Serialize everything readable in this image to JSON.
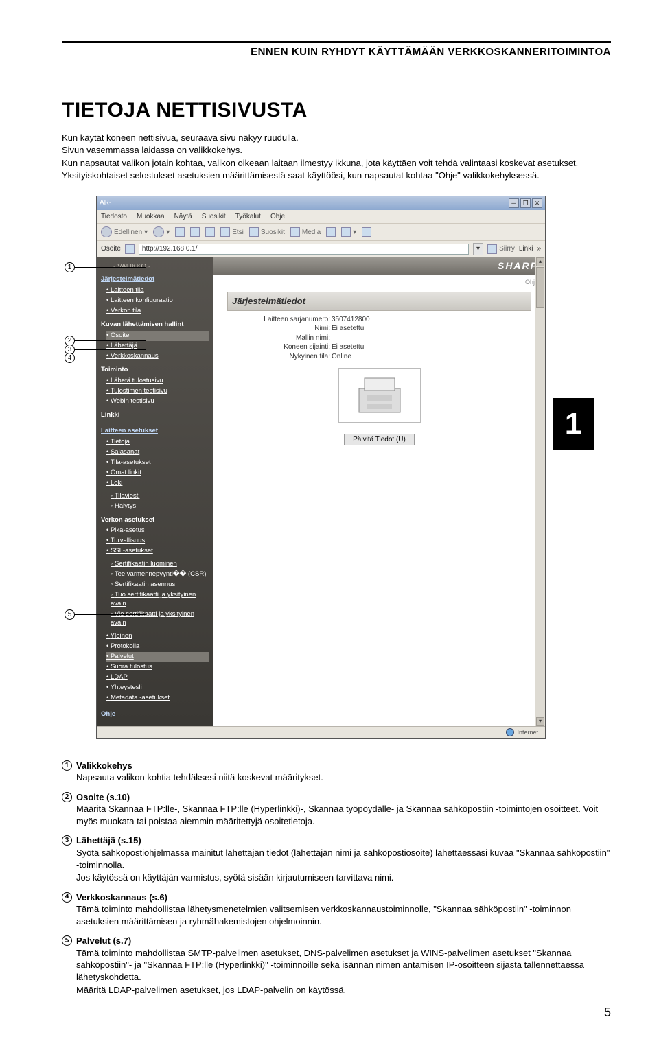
{
  "chapter": "ENNEN KUIN RYHDYT KÄYTTÄMÄÄN VERKKOSKANNERITOIMINTOA",
  "title": "TIETOJA NETTISIVUSTA",
  "intro": [
    "Kun käytät koneen nettisivua, seuraava sivu näkyy ruudulla.",
    "Sivun vasemmassa laidassa on valikkokehys.",
    "Kun napsautat valikon jotain kohtaa, valikon oikeaan laitaan ilmestyy ikkuna, jota käyttäen voit tehdä valintaasi koskevat asetukset.",
    "Yksityiskohtaiset selostukset asetuksien määrittämisestä saat käyttöösi, kun napsautat kohtaa \"Ohje\" valikkokehyksessä."
  ],
  "chapter_tab": "1",
  "browser": {
    "title": "AR-",
    "menus": [
      "Tiedosto",
      "Muokkaa",
      "Näytä",
      "Suosikit",
      "Työkalut",
      "Ohje"
    ],
    "toolbar": {
      "back": "Edellinen",
      "search": "Etsi",
      "fav": "Suosikit",
      "media": "Media"
    },
    "addr_label": "Osoite",
    "addr": "http://192.168.0.1/",
    "go": "Siirry",
    "links": "Linki",
    "sidebar": {
      "menu_header": "- VALIKKO -",
      "sys": "Järjestelmätiedot",
      "sys_items": [
        "Laitteen tila",
        "Laitteen konfiguraatio",
        "Verkon tila"
      ],
      "img": "Kuvan lähettämisen hallint",
      "img_items": [
        "Osoite",
        "Lähettäjä",
        "Verkkoskannaus"
      ],
      "toiminto": "Toiminto",
      "toiminto_items": [
        "Lähetä tulostusivu",
        "Tulostimen testisivu",
        "Webin testisivu"
      ],
      "linkki": "Linkki",
      "devset": "Laitteen asetukset",
      "devset_items": [
        "Tietoja",
        "Salasanat",
        "Tila-asetukset",
        "Omat linkit",
        "Loki"
      ],
      "devset_sub": [
        "Tilaviesti",
        "Halytys"
      ],
      "netset": "Verkon asetukset",
      "netset_items": [
        "Pika-asetus",
        "Turvallisuus",
        "SSL-asetukset"
      ],
      "netset_sub": [
        "Sertifikaatin luominen",
        "Tee varmennepyynti�� (CSR)",
        "Sertifikaatin asennus",
        "Tuo sertifikaatti ja yksityinen avain",
        "Vie sertifikaatti ja yksityinen avain"
      ],
      "netset_items2": [
        "Yleinen",
        "Protokolla",
        "Palvelut",
        "Suora tulostus",
        "LDAP",
        "Yhteystesli",
        "Metadata -asetukset"
      ],
      "ohje": "Ohje"
    },
    "main": {
      "brand": "SHARP",
      "ohje_link": "Ohje",
      "title": "Järjestelmätiedot",
      "rows": {
        "serial_lbl": "Laitteen sarjanumero:",
        "serial": "3507412800",
        "name_lbl": "Nimi:",
        "name": "Ei asetettu",
        "model_lbl": "Mallin nimi:",
        "loc_lbl": "Koneen sijainti:",
        "loc": "Ei asetettu",
        "state_lbl": "Nykyinen tila:",
        "state": "Online"
      },
      "update_btn": "Päivitä Tiedot (U)"
    },
    "status": "Internet"
  },
  "legend": [
    {
      "n": "1",
      "title": "Valikkokehys",
      "body": [
        "Napsauta valikon kohtia tehdäksesi niitä koskevat määritykset."
      ]
    },
    {
      "n": "2",
      "title": "Osoite (s.10)",
      "body": [
        "Määritä Skannaa FTP:lle-, Skannaa FTP:lle (Hyperlinkki)-, Skannaa työpöydälle- ja Skannaa sähköpostiin -toimintojen osoitteet. Voit myös muokata tai poistaa aiemmin määritettyjä osoitetietoja."
      ]
    },
    {
      "n": "3",
      "title": "Lähettäjä (s.15)",
      "body": [
        "Syötä sähköpostiohjelmassa mainitut lähettäjän tiedot (lähettäjän nimi ja sähköpostiosoite) lähettäessäsi kuvaa \"Skannaa sähköpostiin\" -toiminnolla.",
        "Jos käytössä on käyttäjän varmistus, syötä sisään kirjautumiseen tarvittava nimi."
      ]
    },
    {
      "n": "4",
      "title": "Verkkoskannaus (s.6)",
      "body": [
        "Tämä toiminto mahdollistaa lähetysmenetelmien valitsemisen verkkoskannaustoiminnolle, \"Skannaa sähköpostiin\" -toiminnon asetuksien määrittämisen ja ryhmähakemistojen ohjelmoinnin."
      ]
    },
    {
      "n": "5",
      "title": "Palvelut (s.7)",
      "body": [
        "Tämä toiminto mahdollistaa SMTP-palvelimen asetukset, DNS-palvelimen asetukset ja WINS-palvelimen asetukset \"Skannaa sähköpostiin\"- ja \"Skannaa FTP:lle (Hyperlinkki)\" -toiminnoille sekä isännän nimen antamisen IP-osoitteen sijasta tallennettaessa lähetyskohdetta.",
        "Määritä LDAP-palvelimen asetukset, jos LDAP-palvelin on käytössä."
      ]
    }
  ],
  "page_num": "5"
}
